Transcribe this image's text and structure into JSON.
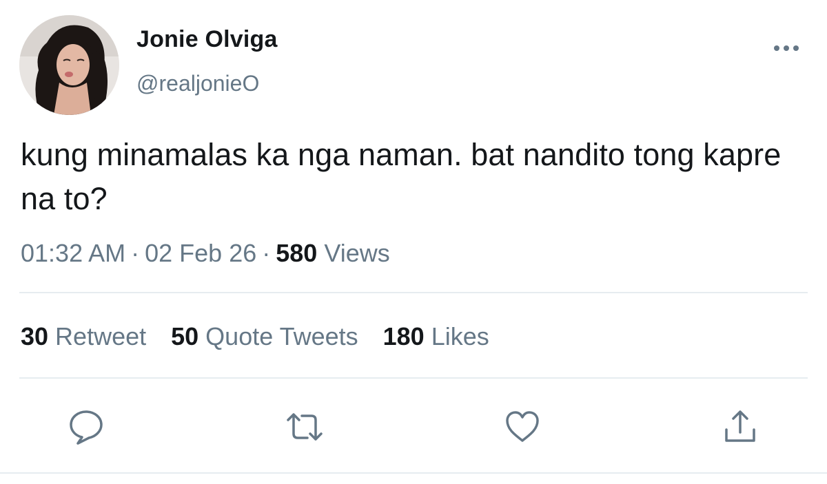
{
  "author": {
    "display_name": "Jonie Olviga",
    "handle": "@realjonieO",
    "avatar": "profile-photo"
  },
  "tweet": {
    "text": "kung minamalas ka nga naman. bat nandito tong kapre na to?",
    "time": "01:32 AM",
    "date": "02 Feb 26",
    "views_count": "580",
    "views_label": "Views"
  },
  "stats": {
    "retweets_count": "30",
    "retweets_label": "Retweet",
    "quotes_count": "50",
    "quotes_label": "Quote Tweets",
    "likes_count": "180",
    "likes_label": "Likes"
  },
  "actions": [
    "reply-icon",
    "retweet-icon",
    "like-icon",
    "share-icon"
  ],
  "menu_icon": "more-options-icon",
  "colors": {
    "text_primary": "#14171a",
    "text_secondary": "#657786",
    "divider": "#e6ecf0",
    "icon": "#657786"
  }
}
